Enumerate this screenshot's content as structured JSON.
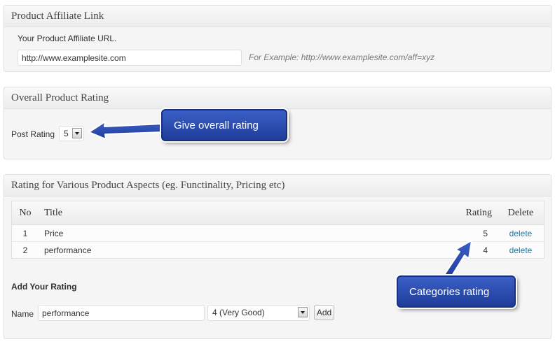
{
  "affiliate": {
    "title": "Product Affiliate Link",
    "label": "Your Product Affiliate URL.",
    "url_value": "http://www.examplesite.com",
    "example": "For Example: http://www.examplesite.com/aff=xyz"
  },
  "overall": {
    "title": "Overall Product Rating",
    "post_rating_label": "Post Rating",
    "post_rating_value": "5",
    "callout": "Give overall rating"
  },
  "aspects": {
    "title": "Rating for Various Product Aspects (eg. Functinality, Pricing etc)",
    "columns": {
      "no": "No",
      "title": "Title",
      "rating": "Rating",
      "delete": "Delete"
    },
    "rows": [
      {
        "no": "1",
        "title": "Price",
        "rating": "5",
        "delete": "delete"
      },
      {
        "no": "2",
        "title": "performance",
        "rating": "4",
        "delete": "delete"
      }
    ],
    "add_heading": "Add Your Rating",
    "name_label": "Name",
    "name_value": "performance",
    "rating_select": "4 (Very Good)",
    "add_button": "Add",
    "callout": "Categories rating"
  },
  "colors": {
    "callout_bg": "#2c4fb5",
    "link": "#21759b",
    "panel_border": "#dfdfdf"
  }
}
